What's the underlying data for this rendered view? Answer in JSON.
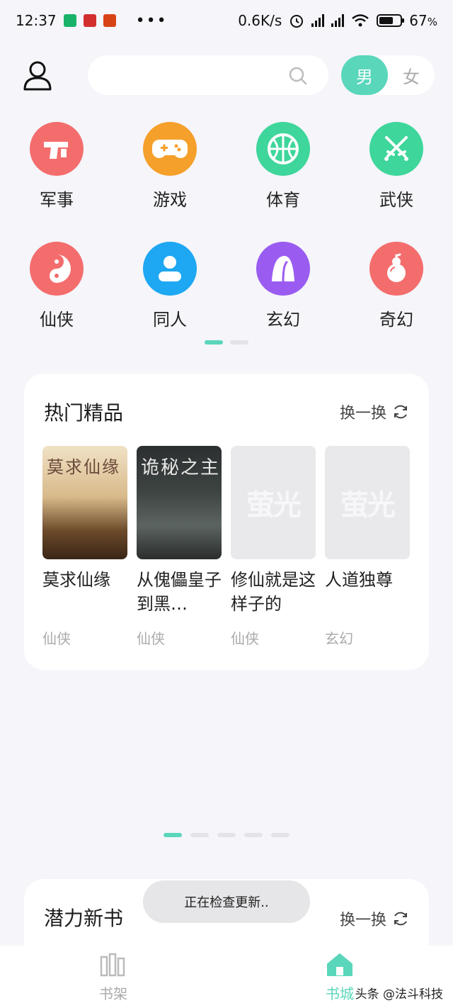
{
  "status_bar": {
    "time": "12:37",
    "speed": "0.6K/s",
    "battery": "67",
    "battery_suffix": "%",
    "battery_level": 0.67,
    "app_colors": [
      "#19b36a",
      "#d32f2f",
      "#d84315"
    ],
    "more": "•••"
  },
  "header": {
    "search": {
      "placeholder": "",
      "value": ""
    },
    "gender": {
      "male": "男",
      "female": "女",
      "selected": "男"
    }
  },
  "categories": [
    {
      "label": "军事",
      "color": "#f46d6d",
      "icon": "gun-icon"
    },
    {
      "label": "游戏",
      "color": "#f5a02a",
      "icon": "gamepad-icon"
    },
    {
      "label": "体育",
      "color": "#3ed69a",
      "icon": "basketball-icon"
    },
    {
      "label": "武侠",
      "color": "#3ed69a",
      "icon": "crossed-swords-icon"
    },
    {
      "label": "仙侠",
      "color": "#f46d6d",
      "icon": "yin-yang-icon"
    },
    {
      "label": "同人",
      "color": "#1ea7f2",
      "icon": "person-icon"
    },
    {
      "label": "玄幻",
      "color": "#9a5cf0",
      "icon": "mountain-icon"
    },
    {
      "label": "奇幻",
      "color": "#f46d6d",
      "icon": "gourd-icon"
    }
  ],
  "hot": {
    "title": "热门精品",
    "swap": "换一换",
    "books": [
      {
        "name": "莫求仙缘",
        "genre": "仙侠",
        "cover_text": "莫求仙缘"
      },
      {
        "name": "从傀儡皇子到黑…",
        "genre": "仙侠",
        "cover_text": "诡秘之主"
      },
      {
        "name": "修仙就是这样子的",
        "genre": "仙侠",
        "cover_text": "萤光"
      },
      {
        "name": "人道独尊",
        "genre": "玄幻",
        "cover_text": "萤光"
      }
    ]
  },
  "potential": {
    "title": "潜力新书",
    "swap": "换一换"
  },
  "toast": "正在检查更新..",
  "bottom_nav": {
    "shelf": "书架",
    "store": "书城",
    "active": "书城",
    "watermark": "头条 @法斗科技"
  },
  "colors": {
    "accent": "#5ad6bb",
    "background": "#f5f5fa"
  }
}
